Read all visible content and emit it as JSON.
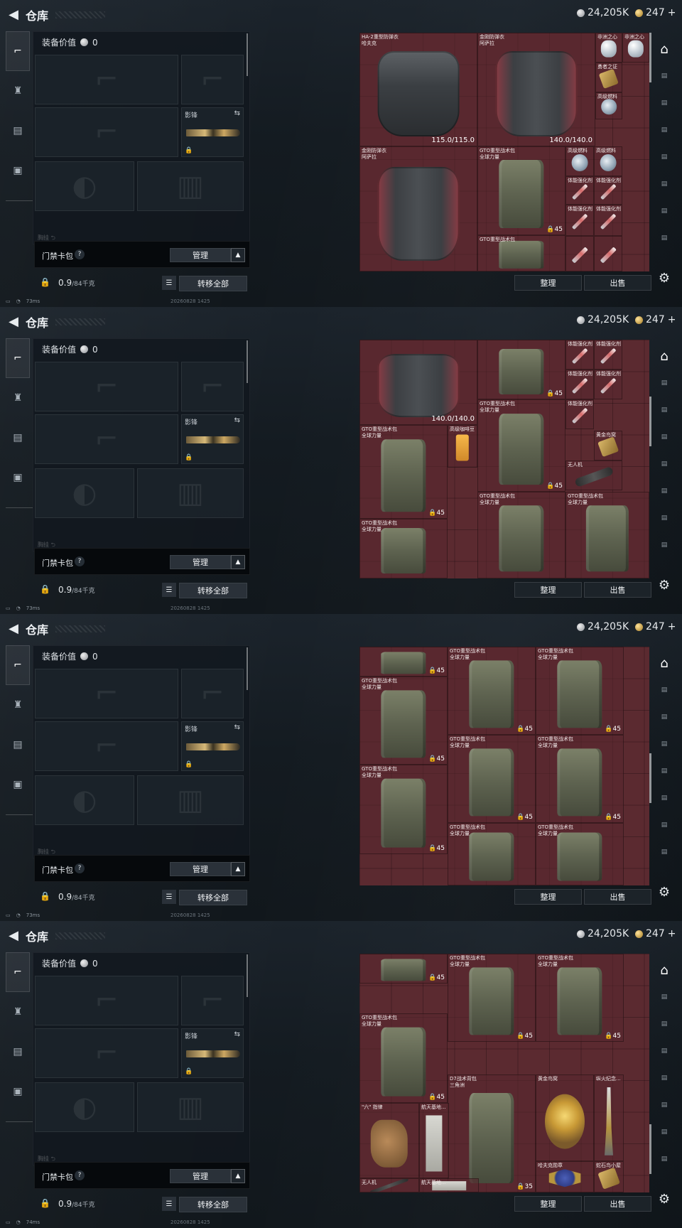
{
  "frames": [
    {
      "header": {
        "title": "仓库",
        "silver": "24,205K",
        "gold": "247"
      },
      "equip": {
        "value_label": "装备价值",
        "value": "0",
        "melee_label": "影锋",
        "bag_title": "门禁卡包",
        "manage": "管理",
        "weight": "0.9",
        "weight_max": "/84千克",
        "transfer": "转移全部",
        "strip": "胸挂 ⮌"
      },
      "status": {
        "ping": "73ms",
        "date": "20260828 1425"
      },
      "stash": {
        "items": [
          {
            "n1": "HA-2重型防弹衣",
            "n2": "哈夫克",
            "tag": "115.0/115.0",
            "kind": "vest"
          },
          {
            "n1": "金刚防弹衣",
            "n2": "阿萨拉",
            "tag": "140.0/140.0",
            "kind": "vest-red"
          },
          {
            "n1": "非洲之心",
            "n2": "",
            "tag": "",
            "kind": "gem"
          },
          {
            "n1": "非洲之心",
            "n2": "",
            "tag": "",
            "kind": "gem"
          },
          {
            "n1": "勇者之证",
            "n2": "",
            "tag": "",
            "kind": "card"
          },
          {
            "n1": "高级燃料",
            "n2": "",
            "tag": "",
            "kind": "can"
          },
          {
            "n1": "金刚防弹衣",
            "n2": "阿萨拉",
            "tag": "",
            "kind": "vest-red"
          },
          {
            "n1": "GTO重型战术包",
            "n2": "全球力量",
            "tag": "45",
            "kind": "backpack"
          },
          {
            "n1": "高级燃料",
            "n2": "",
            "tag": "",
            "kind": "can"
          },
          {
            "n1": "高级燃料",
            "n2": "",
            "tag": "",
            "kind": "can"
          },
          {
            "n1": "体能强化剂",
            "n2": "",
            "tag": "",
            "kind": "syr"
          },
          {
            "n1": "体能强化剂",
            "n2": "",
            "tag": "",
            "kind": "syr"
          },
          {
            "n1": "体能强化剂",
            "n2": "",
            "tag": "",
            "kind": "syr"
          },
          {
            "n1": "体能强化剂",
            "n2": "",
            "tag": "",
            "kind": "syr"
          },
          {
            "n1": "",
            "n2": "",
            "tag": "",
            "kind": "syr"
          },
          {
            "n1": "",
            "n2": "",
            "tag": "",
            "kind": "syr"
          },
          {
            "n1": "GTO重型战术包",
            "n2": "",
            "tag": "",
            "kind": "backpack"
          }
        ]
      },
      "buttons": {
        "sort": "整理",
        "sell": "出售"
      }
    },
    {
      "header": {
        "title": "仓库",
        "silver": "24,205K",
        "gold": "247"
      },
      "equip": {
        "value_label": "装备价值",
        "value": "0",
        "melee_label": "影锋",
        "bag_title": "门禁卡包",
        "manage": "管理",
        "weight": "0.9",
        "weight_max": "/84千克",
        "transfer": "转移全部",
        "strip": "胸挂 ⮌"
      },
      "status": {
        "ping": "73ms",
        "date": "20260828 1425"
      },
      "stash": {
        "items": [
          {
            "n1": "",
            "n2": "",
            "tag": "140.0/140.0",
            "kind": "vest-red"
          },
          {
            "n1": "",
            "n2": "",
            "tag": "45",
            "kind": "backpack"
          },
          {
            "n1": "体能强化剂",
            "n2": "",
            "tag": "",
            "kind": "syr"
          },
          {
            "n1": "体能强化剂",
            "n2": "",
            "tag": "",
            "kind": "syr"
          },
          {
            "n1": "体能强化剂",
            "n2": "",
            "tag": "",
            "kind": "syr"
          },
          {
            "n1": "体能强化剂",
            "n2": "",
            "tag": "",
            "kind": "syr"
          },
          {
            "n1": "GTO重型战术包",
            "n2": "全球力量",
            "tag": "45",
            "kind": "backpack"
          },
          {
            "n1": "体能强化剂",
            "n2": "",
            "tag": "",
            "kind": "syr"
          },
          {
            "n1": "黄金鸟窝",
            "n2": "",
            "tag": "",
            "kind": "card"
          },
          {
            "n1": "无人机",
            "n2": "",
            "tag": "",
            "kind": "gear"
          },
          {
            "n1": "GTO重型战术包",
            "n2": "全球力量",
            "tag": "45",
            "kind": "backpack"
          },
          {
            "n1": "高级咖啡豆",
            "n2": "",
            "tag": "",
            "kind": "mug"
          },
          {
            "n1": "GTO重型战术包",
            "n2": "全球力量",
            "tag": "",
            "kind": "backpack"
          },
          {
            "n1": "GTO重型战术包",
            "n2": "全球力量",
            "tag": "",
            "kind": "backpack"
          },
          {
            "n1": "GTO重型战术包",
            "n2": "全球力量",
            "tag": "",
            "kind": "backpack"
          }
        ]
      },
      "buttons": {
        "sort": "整理",
        "sell": "出售"
      }
    },
    {
      "header": {
        "title": "仓库",
        "silver": "24,205K",
        "gold": "247"
      },
      "equip": {
        "value_label": "装备价值",
        "value": "0",
        "melee_label": "影锋",
        "bag_title": "门禁卡包",
        "manage": "管理",
        "weight": "0.9",
        "weight_max": "/84千克",
        "transfer": "转移全部",
        "strip": "胸挂 ⮌"
      },
      "status": {
        "ping": "73ms",
        "date": "20260828 1425"
      },
      "stash": {
        "items": [
          {
            "n1": "",
            "n2": "",
            "tag": "45",
            "kind": "backpack"
          },
          {
            "n1": "GTO重型战术包",
            "n2": "全球力量",
            "tag": "45",
            "kind": "backpack"
          },
          {
            "n1": "GTO重型战术包",
            "n2": "全球力量",
            "tag": "45",
            "kind": "backpack"
          },
          {
            "n1": "GTO重型战术包",
            "n2": "全球力量",
            "tag": "45",
            "kind": "backpack"
          },
          {
            "n1": "GTO重型战术包",
            "n2": "全球力量",
            "tag": "45",
            "kind": "backpack"
          },
          {
            "n1": "GTO重型战术包",
            "n2": "全球力量",
            "tag": "45",
            "kind": "backpack"
          },
          {
            "n1": "GTO重型战术包",
            "n2": "全球力量",
            "tag": "45",
            "kind": "backpack"
          },
          {
            "n1": "GTO重型战术包",
            "n2": "全球力量",
            "tag": "",
            "kind": "backpack"
          },
          {
            "n1": "GTO重型战术包",
            "n2": "全球力量",
            "tag": "",
            "kind": "backpack"
          }
        ]
      },
      "buttons": {
        "sort": "整理",
        "sell": "出售"
      }
    },
    {
      "header": {
        "title": "仓库",
        "silver": "24,205K",
        "gold": "247"
      },
      "equip": {
        "value_label": "装备价值",
        "value": "0",
        "melee_label": "影锋",
        "bag_title": "门禁卡包",
        "manage": "管理",
        "weight": "0.9",
        "weight_max": "/84千克",
        "transfer": "转移全部",
        "strip": "胸挂 ⮌"
      },
      "status": {
        "ping": "74ms",
        "date": "20260828 1425"
      },
      "stash": {
        "items": [
          {
            "n1": "",
            "n2": "",
            "tag": "45",
            "kind": "backpack"
          },
          {
            "n1": "GTO重型战术包",
            "n2": "全球力量",
            "tag": "45",
            "kind": "backpack"
          },
          {
            "n1": "GTO重型战术包",
            "n2": "全球力量",
            "tag": "45",
            "kind": "backpack"
          },
          {
            "n1": "GTO重型战术包",
            "n2": "全球力量",
            "tag": "45",
            "kind": "backpack"
          },
          {
            "n1": "D7战术背包",
            "n2": "三角洲",
            "tag": "35",
            "kind": "backpack"
          },
          {
            "n1": "黄金鸟窝",
            "n2": "",
            "tag": "",
            "kind": "nest"
          },
          {
            "n1": "纵火纪念...",
            "n2": "",
            "tag": "",
            "kind": "trophy"
          },
          {
            "n1": "\"六\" 指律",
            "n2": "",
            "tag": "",
            "kind": "glove"
          },
          {
            "n1": "航天基地...",
            "n2": "",
            "tag": "",
            "kind": "paper"
          },
          {
            "n1": "哈夫克勋章",
            "n2": "",
            "tag": "",
            "kind": "medal"
          },
          {
            "n1": "无人机",
            "n2": "",
            "tag": "",
            "kind": "gear"
          },
          {
            "n1": "航天基地...",
            "n2": "",
            "tag": "",
            "kind": "paper"
          },
          {
            "n1": "蛇石鸟小屋",
            "n2": "",
            "tag": "",
            "kind": "card"
          }
        ]
      },
      "buttons": {
        "sort": "整理",
        "sell": "出售"
      }
    }
  ]
}
